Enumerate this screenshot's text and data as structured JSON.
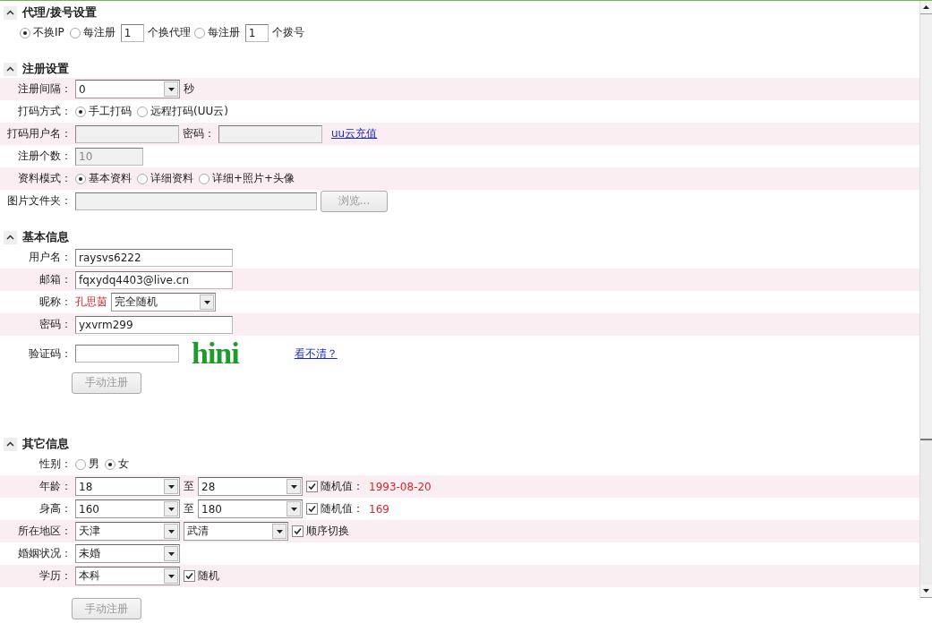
{
  "sections": [
    {
      "title": "代理/拨号设置",
      "expanded": true,
      "rows": [
        {
          "shaded": false,
          "items": [
            {
              "kind": "radio",
              "label": "不换IP",
              "selected": true
            },
            {
              "kind": "radio",
              "label": "每注册",
              "selected": false
            },
            {
              "kind": "tiny-input",
              "value": "1",
              "disabled": false
            },
            {
              "kind": "text",
              "text": "个换代理"
            },
            {
              "kind": "radio",
              "label": "每注册",
              "selected": false
            },
            {
              "kind": "tiny-input",
              "value": "1",
              "disabled": false
            },
            {
              "kind": "text",
              "text": "个拨号"
            }
          ]
        }
      ]
    },
    {
      "title": "注册设置",
      "expanded": true,
      "rows": [
        {
          "label": "注册间隔：",
          "shaded": true,
          "items": [
            {
              "kind": "select",
              "value": "0"
            },
            {
              "kind": "text",
              "text": "秒"
            }
          ]
        },
        {
          "label": "打码方式：",
          "shaded": false,
          "items": [
            {
              "kind": "radio",
              "label": "手工打码",
              "selected": true
            },
            {
              "kind": "radio",
              "label": "远程打码(UU云)",
              "selected": false
            }
          ]
        },
        {
          "label": "打码用户名：",
          "shaded": true,
          "items": [
            {
              "kind": "input",
              "disabled": true
            },
            {
              "kind": "text",
              "text": "密码："
            },
            {
              "kind": "input",
              "disabled": true
            },
            {
              "kind": "link",
              "text": "uu云充值"
            }
          ]
        },
        {
          "label": "注册个数：",
          "shaded": false,
          "items": [
            {
              "kind": "short-input",
              "value": "10",
              "disabled": true
            }
          ]
        },
        {
          "label": "资料模式：",
          "shaded": true,
          "items": [
            {
              "kind": "radio",
              "label": "基本资料",
              "selected": true
            },
            {
              "kind": "radio",
              "label": "详细资料",
              "selected": false
            },
            {
              "kind": "radio",
              "label": "详细+照片+头像",
              "selected": false
            }
          ]
        },
        {
          "label": "图片文件夹：",
          "shaded": false,
          "items": [
            {
              "kind": "wide-input",
              "disabled": true
            },
            {
              "kind": "button",
              "label": "浏览...",
              "disabled": true
            }
          ]
        }
      ]
    },
    {
      "title": "基本信息",
      "expanded": true,
      "rows": [
        {
          "label": "用户名：",
          "shaded": false,
          "items": [
            {
              "kind": "long-input",
              "value": "raysvs6222",
              "disabled": false
            }
          ]
        },
        {
          "label": "邮箱：",
          "shaded": true,
          "items": [
            {
              "kind": "long-input",
              "value": "fqxydq4403@live.cn",
              "disabled": false
            }
          ]
        },
        {
          "label": "昵称：",
          "shaded": false,
          "items": [
            {
              "kind": "value",
              "text": "孔思茵"
            },
            {
              "kind": "select",
              "value": "完全随机"
            }
          ]
        },
        {
          "label": "密码：",
          "shaded": true,
          "items": [
            {
              "kind": "long-input",
              "value": "yxvrm299",
              "disabled": false
            }
          ]
        },
        {
          "label": "验证码：",
          "shaded": false,
          "items": [
            {
              "kind": "input",
              "disabled": false
            },
            {
              "kind": "captcha",
              "text": "hini"
            },
            {
              "kind": "link",
              "text": "看不清？"
            }
          ]
        },
        {
          "shaded": false,
          "items": [
            {
              "kind": "button",
              "label": "手动注册",
              "disabled": true
            }
          ]
        }
      ]
    },
    {
      "title": "其它信息",
      "expanded": true,
      "rows": [
        {
          "label": "性别：",
          "shaded": false,
          "items": [
            {
              "kind": "radio",
              "label": "男",
              "selected": false
            },
            {
              "kind": "radio",
              "label": "女",
              "selected": true
            }
          ]
        },
        {
          "label": "年龄：",
          "shaded": true,
          "items": [
            {
              "kind": "select",
              "value": "18"
            },
            {
              "kind": "text",
              "text": "至"
            },
            {
              "kind": "select",
              "value": "28"
            },
            {
              "kind": "checkbox",
              "label": "随机值：",
              "checked": true
            },
            {
              "kind": "value",
              "text": "1993-08-20"
            }
          ]
        },
        {
          "label": "身高：",
          "shaded": false,
          "items": [
            {
              "kind": "select",
              "value": "160"
            },
            {
              "kind": "text",
              "text": "至"
            },
            {
              "kind": "select",
              "value": "180"
            },
            {
              "kind": "checkbox",
              "label": "随机值：",
              "checked": true
            },
            {
              "kind": "value",
              "text": "169"
            }
          ]
        },
        {
          "label": "所在地区：",
          "shaded": true,
          "items": [
            {
              "kind": "select",
              "value": "天津"
            },
            {
              "kind": "select",
              "value": "武清"
            },
            {
              "kind": "checkbox",
              "label": "顺序切换",
              "checked": true
            }
          ]
        },
        {
          "label": "婚姻状况：",
          "shaded": false,
          "items": [
            {
              "kind": "select",
              "value": "未婚"
            }
          ]
        },
        {
          "label": "学历：",
          "shaded": true,
          "items": [
            {
              "kind": "select",
              "value": "本科"
            },
            {
              "kind": "checkbox",
              "label": "随机",
              "checked": true
            }
          ]
        }
      ]
    }
  ],
  "footer": {
    "button": {
      "label": "手动注册",
      "disabled": true
    }
  }
}
